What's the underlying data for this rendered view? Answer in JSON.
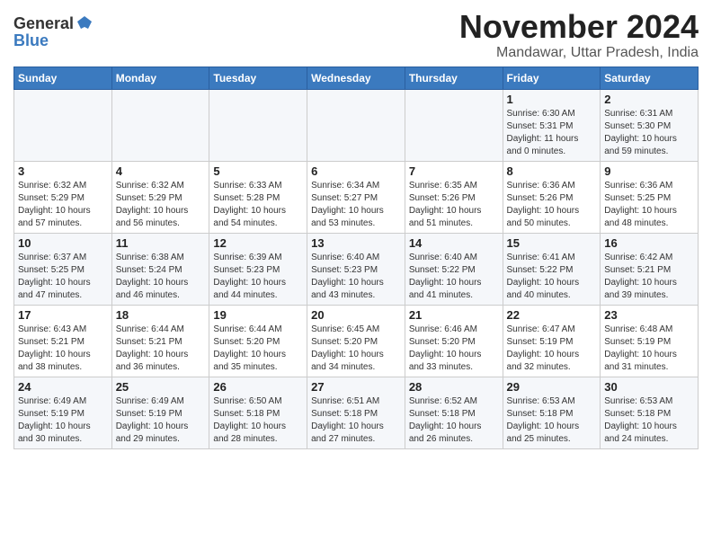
{
  "header": {
    "logo_line1": "General",
    "logo_line2": "Blue",
    "title": "November 2024",
    "subtitle": "Mandawar, Uttar Pradesh, India"
  },
  "calendar": {
    "days_of_week": [
      "Sunday",
      "Monday",
      "Tuesday",
      "Wednesday",
      "Thursday",
      "Friday",
      "Saturday"
    ],
    "weeks": [
      [
        {
          "day": "",
          "info": ""
        },
        {
          "day": "",
          "info": ""
        },
        {
          "day": "",
          "info": ""
        },
        {
          "day": "",
          "info": ""
        },
        {
          "day": "",
          "info": ""
        },
        {
          "day": "1",
          "info": "Sunrise: 6:30 AM\nSunset: 5:31 PM\nDaylight: 11 hours\nand 0 minutes."
        },
        {
          "day": "2",
          "info": "Sunrise: 6:31 AM\nSunset: 5:30 PM\nDaylight: 10 hours\nand 59 minutes."
        }
      ],
      [
        {
          "day": "3",
          "info": "Sunrise: 6:32 AM\nSunset: 5:29 PM\nDaylight: 10 hours\nand 57 minutes."
        },
        {
          "day": "4",
          "info": "Sunrise: 6:32 AM\nSunset: 5:29 PM\nDaylight: 10 hours\nand 56 minutes."
        },
        {
          "day": "5",
          "info": "Sunrise: 6:33 AM\nSunset: 5:28 PM\nDaylight: 10 hours\nand 54 minutes."
        },
        {
          "day": "6",
          "info": "Sunrise: 6:34 AM\nSunset: 5:27 PM\nDaylight: 10 hours\nand 53 minutes."
        },
        {
          "day": "7",
          "info": "Sunrise: 6:35 AM\nSunset: 5:26 PM\nDaylight: 10 hours\nand 51 minutes."
        },
        {
          "day": "8",
          "info": "Sunrise: 6:36 AM\nSunset: 5:26 PM\nDaylight: 10 hours\nand 50 minutes."
        },
        {
          "day": "9",
          "info": "Sunrise: 6:36 AM\nSunset: 5:25 PM\nDaylight: 10 hours\nand 48 minutes."
        }
      ],
      [
        {
          "day": "10",
          "info": "Sunrise: 6:37 AM\nSunset: 5:25 PM\nDaylight: 10 hours\nand 47 minutes."
        },
        {
          "day": "11",
          "info": "Sunrise: 6:38 AM\nSunset: 5:24 PM\nDaylight: 10 hours\nand 46 minutes."
        },
        {
          "day": "12",
          "info": "Sunrise: 6:39 AM\nSunset: 5:23 PM\nDaylight: 10 hours\nand 44 minutes."
        },
        {
          "day": "13",
          "info": "Sunrise: 6:40 AM\nSunset: 5:23 PM\nDaylight: 10 hours\nand 43 minutes."
        },
        {
          "day": "14",
          "info": "Sunrise: 6:40 AM\nSunset: 5:22 PM\nDaylight: 10 hours\nand 41 minutes."
        },
        {
          "day": "15",
          "info": "Sunrise: 6:41 AM\nSunset: 5:22 PM\nDaylight: 10 hours\nand 40 minutes."
        },
        {
          "day": "16",
          "info": "Sunrise: 6:42 AM\nSunset: 5:21 PM\nDaylight: 10 hours\nand 39 minutes."
        }
      ],
      [
        {
          "day": "17",
          "info": "Sunrise: 6:43 AM\nSunset: 5:21 PM\nDaylight: 10 hours\nand 38 minutes."
        },
        {
          "day": "18",
          "info": "Sunrise: 6:44 AM\nSunset: 5:21 PM\nDaylight: 10 hours\nand 36 minutes."
        },
        {
          "day": "19",
          "info": "Sunrise: 6:44 AM\nSunset: 5:20 PM\nDaylight: 10 hours\nand 35 minutes."
        },
        {
          "day": "20",
          "info": "Sunrise: 6:45 AM\nSunset: 5:20 PM\nDaylight: 10 hours\nand 34 minutes."
        },
        {
          "day": "21",
          "info": "Sunrise: 6:46 AM\nSunset: 5:20 PM\nDaylight: 10 hours\nand 33 minutes."
        },
        {
          "day": "22",
          "info": "Sunrise: 6:47 AM\nSunset: 5:19 PM\nDaylight: 10 hours\nand 32 minutes."
        },
        {
          "day": "23",
          "info": "Sunrise: 6:48 AM\nSunset: 5:19 PM\nDaylight: 10 hours\nand 31 minutes."
        }
      ],
      [
        {
          "day": "24",
          "info": "Sunrise: 6:49 AM\nSunset: 5:19 PM\nDaylight: 10 hours\nand 30 minutes."
        },
        {
          "day": "25",
          "info": "Sunrise: 6:49 AM\nSunset: 5:19 PM\nDaylight: 10 hours\nand 29 minutes."
        },
        {
          "day": "26",
          "info": "Sunrise: 6:50 AM\nSunset: 5:18 PM\nDaylight: 10 hours\nand 28 minutes."
        },
        {
          "day": "27",
          "info": "Sunrise: 6:51 AM\nSunset: 5:18 PM\nDaylight: 10 hours\nand 27 minutes."
        },
        {
          "day": "28",
          "info": "Sunrise: 6:52 AM\nSunset: 5:18 PM\nDaylight: 10 hours\nand 26 minutes."
        },
        {
          "day": "29",
          "info": "Sunrise: 6:53 AM\nSunset: 5:18 PM\nDaylight: 10 hours\nand 25 minutes."
        },
        {
          "day": "30",
          "info": "Sunrise: 6:53 AM\nSunset: 5:18 PM\nDaylight: 10 hours\nand 24 minutes."
        }
      ]
    ]
  }
}
